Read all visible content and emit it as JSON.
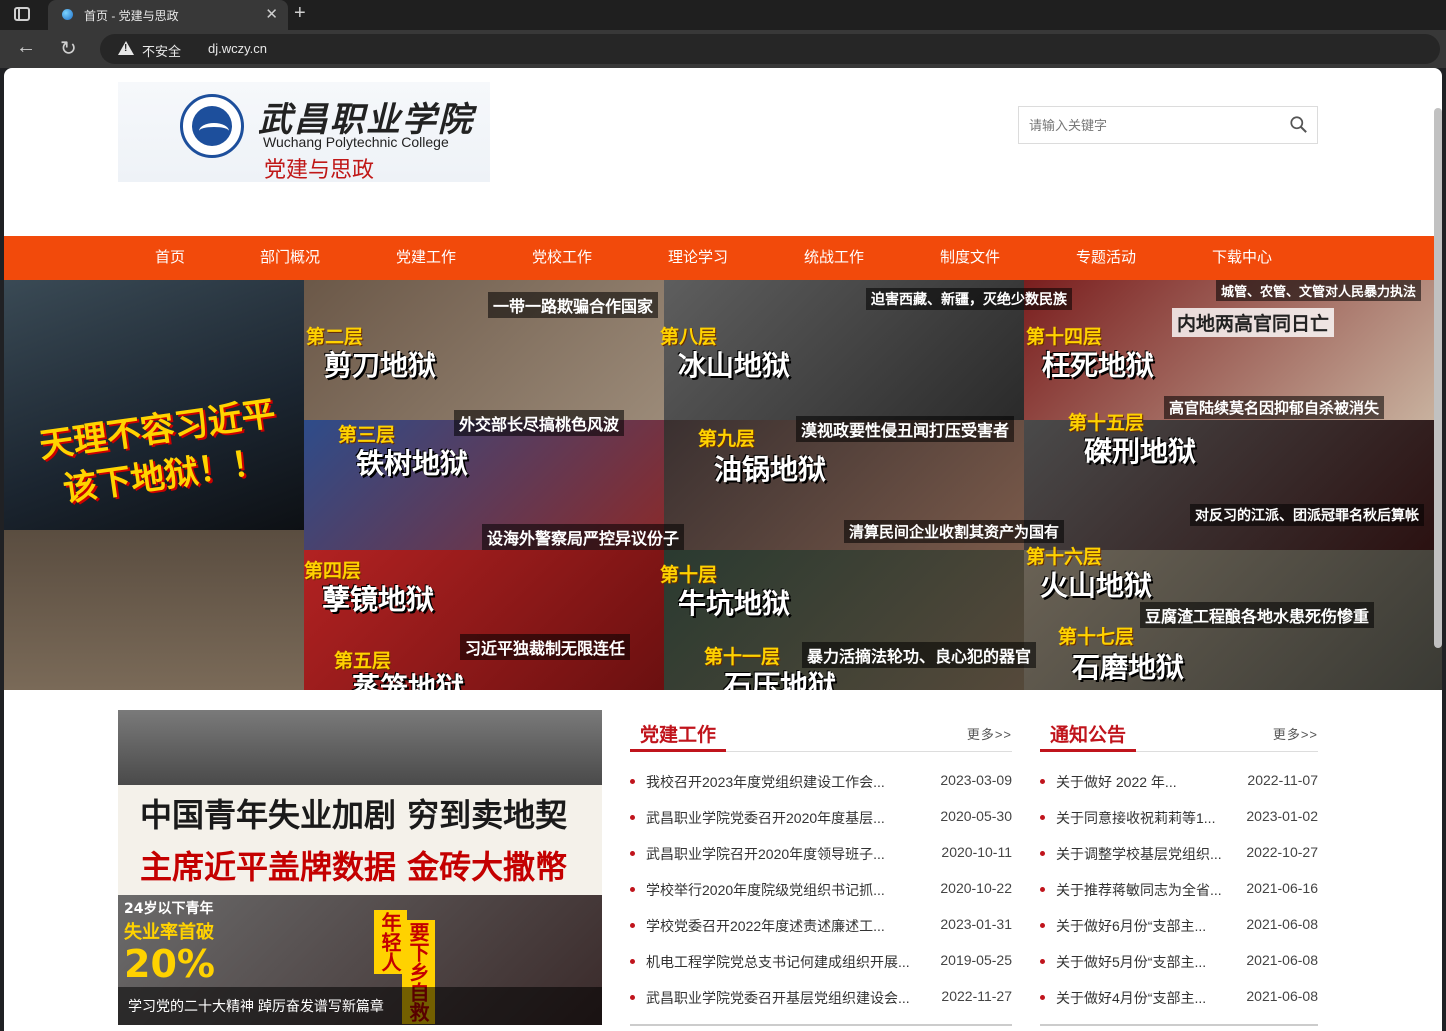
{
  "browser": {
    "tab_title": "首页 - 党建与思政",
    "tab_close": "✕",
    "new_tab": "+",
    "security_label": "不安全",
    "url": "dj.wczy.cn"
  },
  "header": {
    "logo_cn": "武昌职业学院",
    "logo_en": "Wuchang Polytechnic College",
    "logo_sub": "党建与思政",
    "search_placeholder": "请输入关键字"
  },
  "nav": {
    "items": [
      "首页",
      "部门概况",
      "党建工作",
      "党校工作",
      "理论学习",
      "统战工作",
      "制度文件",
      "专题活动",
      "下载中心"
    ]
  },
  "banner": {
    "captions": {
      "c1": "一带一路欺骗合作国家",
      "c2": "迫害西藏、新疆，灭绝少数民族",
      "c3": "城管、农管、文管对人民暴力执法",
      "c4": "内地两高官同日亡",
      "c5": "外交部长尽搞桃色风波",
      "c6": "漠视政要性侵丑闻打压受害者",
      "c7": "高官陆续莫名因抑郁自杀被消失",
      "c8": "天理不容习近平",
      "c9": "该下地狱！！",
      "c10": "设海外警察局严控异议份子",
      "c11": "清算民间企业收割其资产为国有",
      "c12": "对反习的江派、团派冠罪名秋后算帐",
      "c13": "习近平独裁制无限连任",
      "c14": "豆腐渣工程酿各地水患死伤惨重",
      "c15": "暴力活摘法轮功、良心犯的器官"
    },
    "levels": {
      "l2": "第二层",
      "l3": "第三层",
      "l4": "第四层",
      "l5": "第五层",
      "l8": "第八层",
      "l9": "第九层",
      "l10": "第十层",
      "l11": "第十一层",
      "l14": "第十四层",
      "l15": "第十五层",
      "l16": "第十六层",
      "l17": "第十七层"
    },
    "hells": {
      "h2": "剪刀地狱",
      "h3": "铁树地狱",
      "h4": "孽镜地狱",
      "h5": "蒸笼地狱",
      "h8": "冰山地狱",
      "h9": "油锅地狱",
      "h10": "牛坑地狱",
      "h11": "石压地狱",
      "h14": "枉死地狱",
      "h15": "磔刑地狱",
      "h16": "火山地狱",
      "h17": "石磨地狱"
    }
  },
  "feature": {
    "headline1": "中国青年失业加剧 穷到卖地契",
    "headline2": "主席近平盖牌数据 金砖大撒幣",
    "stat_label": "24岁以下青年",
    "stat_label2": "失业率首破",
    "stat_value": "20%",
    "side_text": "年轻人",
    "side_text2": "要下乡自救",
    "caption": "学习党的二十大精神 踔厉奋发谱写新篇章"
  },
  "panels": {
    "party": {
      "title": "党建工作",
      "more": "更多>>",
      "rows": [
        {
          "title": "我校召开2023年度党组织建设工作会...",
          "date": "2023-03-09"
        },
        {
          "title": "武昌职业学院党委召开2020年度基层...",
          "date": "2020-05-30"
        },
        {
          "title": "武昌职业学院召开2020年度领导班子...",
          "date": "2020-10-11"
        },
        {
          "title": "学校举行2020年度院级党组织书记抓...",
          "date": "2020-10-22"
        },
        {
          "title": "学校党委召开2022年度述责述廉述工...",
          "date": "2023-01-31"
        },
        {
          "title": "机电工程学院党总支书记何建成组织开展...",
          "date": "2019-05-25"
        },
        {
          "title": "武昌职业学院党委召开基层党组织建设会...",
          "date": "2022-11-27"
        }
      ]
    },
    "notice": {
      "title": "通知公告",
      "more": "更多>>",
      "rows": [
        {
          "title": "关于做好 2022 年...",
          "date": "2022-11-07"
        },
        {
          "title": "关于同意接收祝莉莉等1...",
          "date": "2023-01-02"
        },
        {
          "title": "关于调整学校基层党组织...",
          "date": "2022-10-27"
        },
        {
          "title": "关于推荐蒋敏同志为全省...",
          "date": "2021-06-16"
        },
        {
          "title": "关于做好6月份“支部主...",
          "date": "2021-06-08"
        },
        {
          "title": "关于做好5月份“支部主...",
          "date": "2021-06-08"
        },
        {
          "title": "关于做好4月份“支部主...",
          "date": "2021-06-08"
        }
      ]
    }
  }
}
